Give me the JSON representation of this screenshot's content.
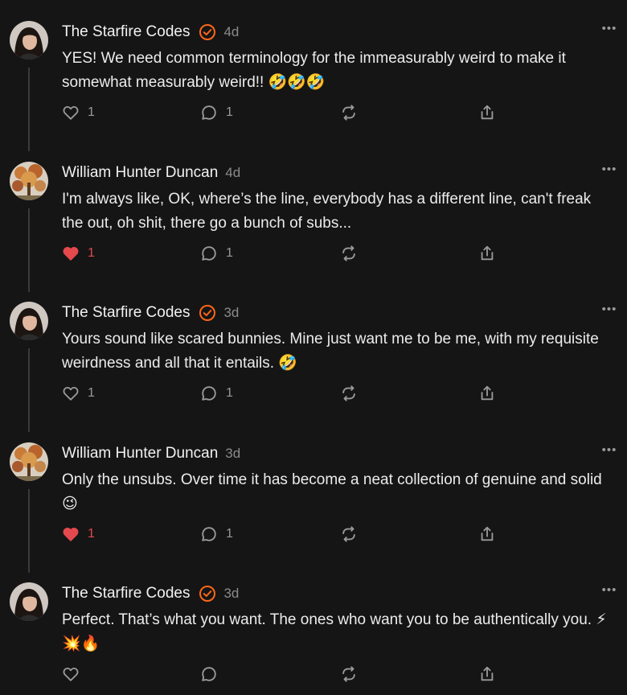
{
  "comments": [
    {
      "author": "The Starfire Codes",
      "verified": true,
      "time": "4d",
      "text": "YES! We need common terminology for the immeasurably weird to make it somewhat measurably weird!! 🤣🤣🤣",
      "likes": "1",
      "liked": false,
      "replies": "1",
      "avatar": "woman-portrait"
    },
    {
      "author": "William Hunter Duncan",
      "verified": false,
      "time": "4d",
      "text": "I'm always like, OK, where’s the line, everybody has a different line, can't freak the out, oh shit, there go a bunch of subs...",
      "likes": "1",
      "liked": true,
      "replies": "1",
      "avatar": "autumn-tree"
    },
    {
      "author": "The Starfire Codes",
      "verified": true,
      "time": "3d",
      "text": "Yours sound like scared bunnies. Mine just want me to be me, with my requisite weirdness and all that it entails. 🤣",
      "likes": "1",
      "liked": false,
      "replies": "1",
      "avatar": "woman-portrait"
    },
    {
      "author": "William Hunter Duncan",
      "verified": false,
      "time": "3d",
      "text": "Only the unsubs. Over time it has become a neat collection of genuine and solid 😉",
      "likes": "1",
      "liked": true,
      "replies": "1",
      "avatar": "autumn-tree"
    },
    {
      "author": "The Starfire Codes",
      "verified": true,
      "time": "3d",
      "text": "Perfect. That’s what you want. The ones who want you to be authentically you. ⚡💥🔥",
      "likes": "",
      "liked": false,
      "replies": "",
      "avatar": "woman-portrait"
    }
  ],
  "icons": {
    "more": "more-horizontal-icon",
    "like": "heart-icon",
    "reply": "comment-bubble-icon",
    "restack": "restack-icon",
    "share": "share-icon",
    "verified": "verified-badge-icon"
  },
  "colors": {
    "background": "#151515",
    "accent": "#ff6719",
    "liked": "#e5484d",
    "muted": "#8b8b8b"
  }
}
